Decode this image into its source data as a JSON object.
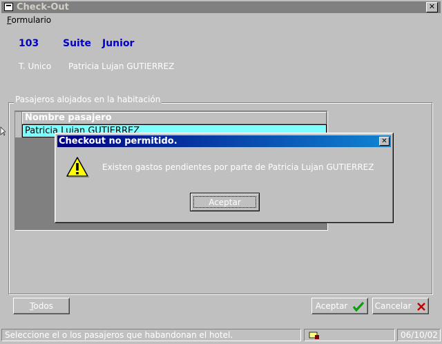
{
  "window": {
    "title": "Check-Out",
    "close_glyph": "✕"
  },
  "menu": {
    "first_letter": "F",
    "rest": "ormulario"
  },
  "room": {
    "number": "103",
    "type": "Suite",
    "category": "Junior",
    "tariff": "T. Unico",
    "holder": "Patricia Lujan  GUTIERREZ"
  },
  "group": {
    "label": "Pasajeros alojados en la habitación"
  },
  "grid": {
    "header": "Nombre pasajero",
    "rows": [
      "Patricia Lujan  GUTIERREZ"
    ]
  },
  "buttons": {
    "todos_first": "T",
    "todos_rest": "odos",
    "aceptar": "Aceptar",
    "cancelar": "Cancelar"
  },
  "status": {
    "message": "Seleccione el o los pasajeros que habandonan el hotel.",
    "date": "06/10/02"
  },
  "dialog": {
    "title": "Checkout no permitido.",
    "message": "Existen gastos pendientes por parte de Patricia Lujan  GUTIERREZ",
    "ok": "Aceptar",
    "close_glyph": "✕"
  },
  "icons": {
    "app": "form-icon",
    "warning": "warning-icon",
    "check": "checkmark-icon",
    "cancel": "cancel-x-icon",
    "status": "keyboard-icon"
  },
  "colors": {
    "window_bg": "#c0c0c0",
    "title_inactive": "#808080",
    "dialog_title_start": "#000080",
    "dialog_title_end": "#1084d0",
    "room_text": "#0000c8",
    "grid_selection": "#80ffff"
  }
}
